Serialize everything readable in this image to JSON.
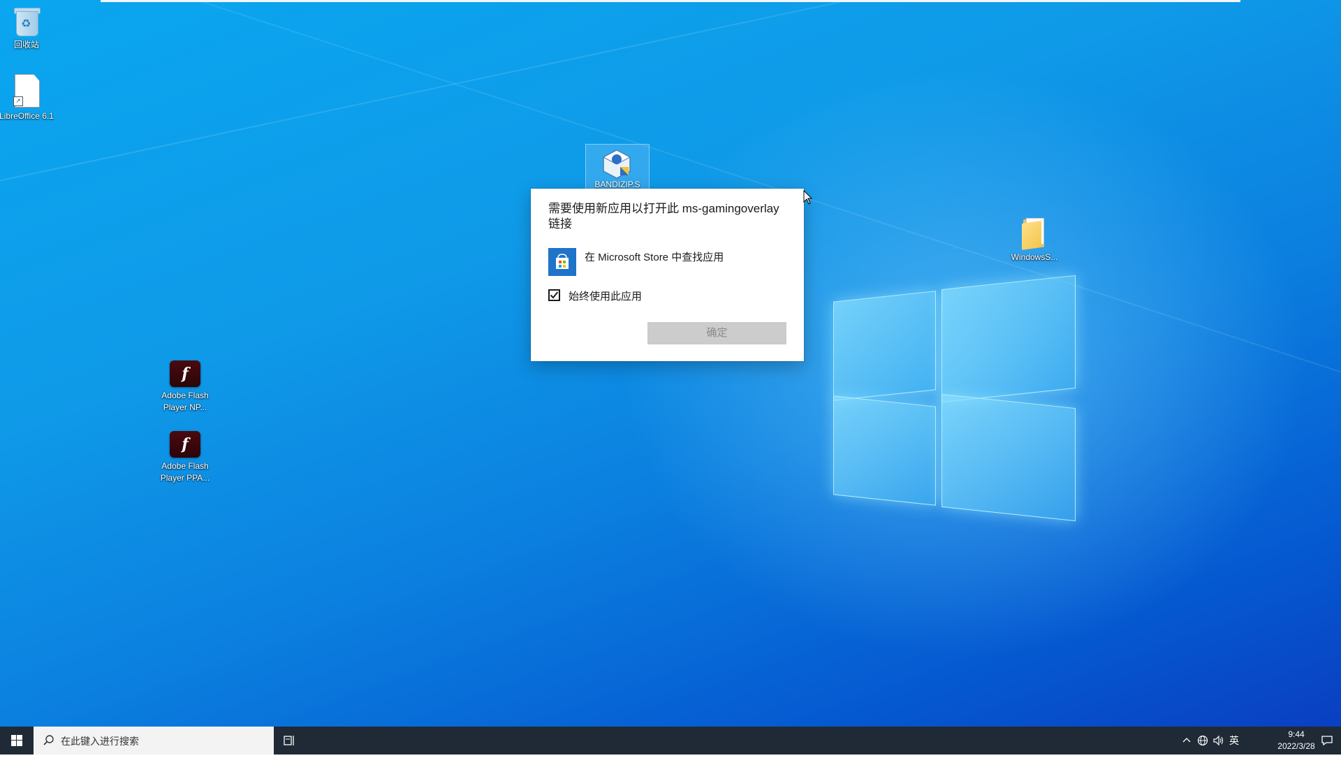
{
  "desktop": {
    "icons": [
      {
        "label": "回收站",
        "icon": "recycle-bin-icon"
      },
      {
        "label": "LibreOffice 6.1",
        "icon": "libreoffice-shortcut-icon"
      },
      {
        "label": "BANDIZIP.S",
        "icon": "bandizip-setup-icon"
      },
      {
        "label": "WindowsS...",
        "icon": "folder-icon"
      },
      {
        "label": "Adobe Flash Player NP...",
        "icon": "adobe-flash-icon"
      },
      {
        "label": "Adobe Flash Player PPA...",
        "icon": "adobe-flash-icon"
      }
    ]
  },
  "dialog": {
    "title": "需要使用新应用以打开此 ms-gamingoverlay 链接",
    "store_option": "在 Microsoft Store 中查找应用",
    "always_use_label": "始终使用此应用",
    "always_use_checked": true,
    "ok_label": "确定"
  },
  "taskbar": {
    "search_placeholder": "在此键入进行搜索",
    "tray": {
      "ime": "英",
      "time": "9:44",
      "date": "2022/3/28"
    }
  },
  "colors": {
    "store_tile": "#1f73c9",
    "taskbar": "#1f2a36",
    "ok_button_disabled": "#cccccc"
  }
}
